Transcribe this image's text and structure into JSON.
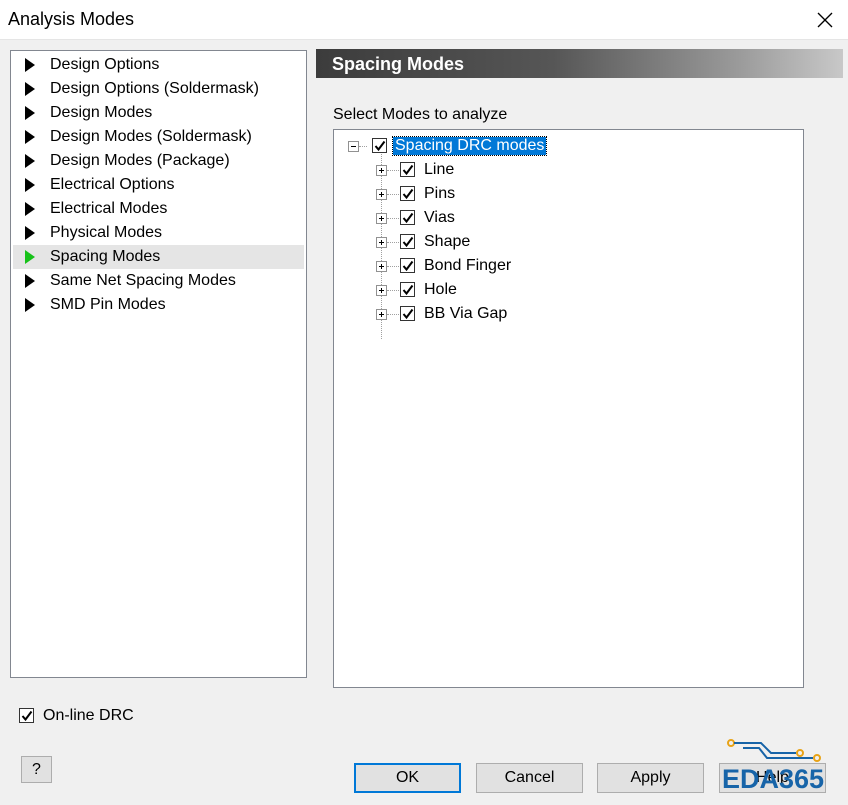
{
  "window": {
    "title": "Analysis Modes"
  },
  "nav": {
    "items": [
      {
        "label": "Design Options"
      },
      {
        "label": "Design Options (Soldermask)"
      },
      {
        "label": "Design Modes"
      },
      {
        "label": "Design Modes (Soldermask)"
      },
      {
        "label": "Design Modes (Package)"
      },
      {
        "label": "Electrical Options"
      },
      {
        "label": "Electrical Modes"
      },
      {
        "label": "Physical Modes"
      },
      {
        "label": "Spacing Modes",
        "selected": true
      },
      {
        "label": "Same Net Spacing Modes"
      },
      {
        "label": "SMD Pin Modes"
      }
    ]
  },
  "panel": {
    "header": "Spacing Modes",
    "select_label": "Select Modes to analyze",
    "tree": {
      "root": {
        "label": "Spacing DRC modes",
        "checked": true,
        "expanded": true
      },
      "children": [
        {
          "label": "Line",
          "checked": true
        },
        {
          "label": "Pins",
          "checked": true
        },
        {
          "label": "Vias",
          "checked": true
        },
        {
          "label": "Shape",
          "checked": true
        },
        {
          "label": "Bond Finger",
          "checked": true
        },
        {
          "label": "Hole",
          "checked": true
        },
        {
          "label": "BB Via Gap",
          "checked": true
        }
      ]
    }
  },
  "online_drc": {
    "label": "On-line DRC",
    "checked": true
  },
  "buttons": {
    "help_question": "?",
    "ok": "OK",
    "cancel": "Cancel",
    "apply": "Apply",
    "help": "Help"
  },
  "logo": {
    "text": "EDA365"
  },
  "colors": {
    "selected_arrow": "#17c21a",
    "selection_blue": "#0078d7",
    "logo_blue": "#1764a8"
  }
}
